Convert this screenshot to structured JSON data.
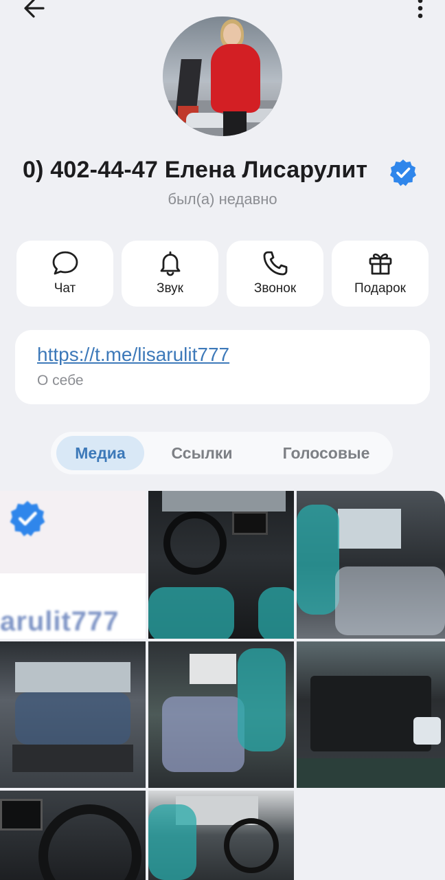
{
  "topbar": {
    "back_icon": "arrow-left-icon",
    "more_icon": "more-vertical-icon"
  },
  "profile": {
    "name": "0) 402-44-47 Елена Лисарулит",
    "status": "был(а) недавно",
    "verified_color": "#2f86eb"
  },
  "actions": [
    {
      "label": "Чат",
      "icon": "chat-bubble-icon"
    },
    {
      "label": "Звук",
      "icon": "bell-icon"
    },
    {
      "label": "Звонок",
      "icon": "phone-icon"
    },
    {
      "label": "Подарок",
      "icon": "gift-icon"
    }
  ],
  "bio": {
    "link": "https://t.me/lisarulit777",
    "caption": "О себе"
  },
  "tabs": [
    {
      "label": "Медиа",
      "active": true
    },
    {
      "label": "Ссылки",
      "active": false
    },
    {
      "label": "Голосовые",
      "active": false
    }
  ],
  "media": {
    "first_tile_text": "arulit777"
  },
  "colors": {
    "accent": "#3d79b9",
    "background": "#eff0f4",
    "card": "#ffffff"
  }
}
